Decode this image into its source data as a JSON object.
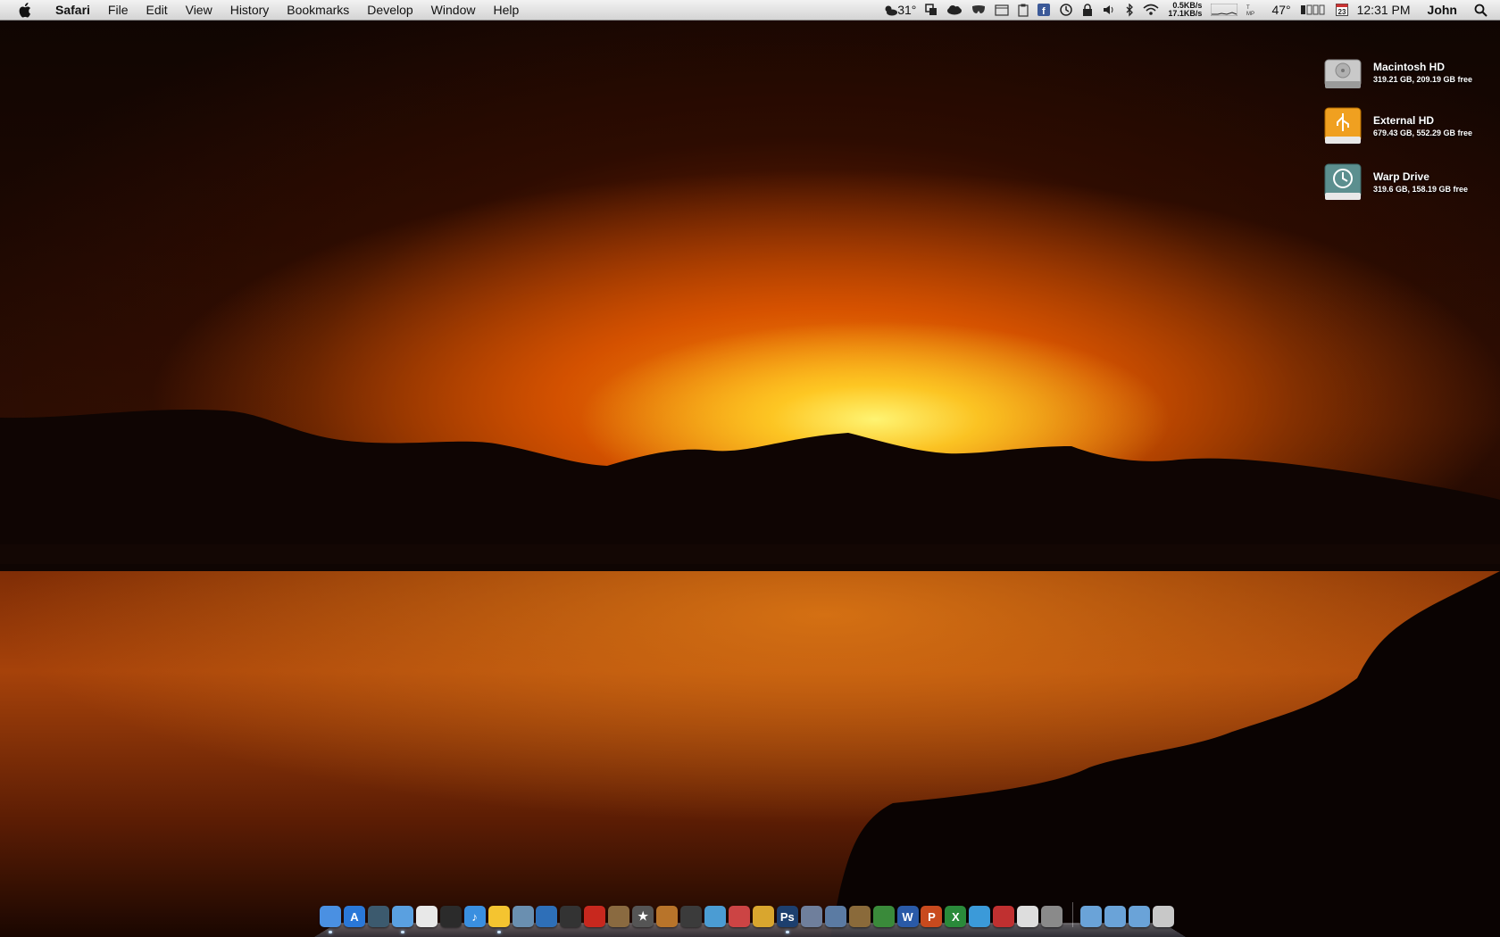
{
  "menubar": {
    "app_name": "Safari",
    "menus": [
      "File",
      "Edit",
      "View",
      "History",
      "Bookmarks",
      "Develop",
      "Window",
      "Help"
    ],
    "weather": "31°",
    "net_up": "0.5KB/s",
    "net_down": "17.1KB/s",
    "temp": "47°",
    "date_day": "23",
    "clock": "12:31 PM",
    "user": "John",
    "icons": [
      "apple-icon",
      "weather-icon",
      "screen-sharing-icon",
      "cloud-icon",
      "mask-icon",
      "window-icon",
      "clipboard-icon",
      "facebook-icon",
      "time-machine-icon",
      "lock-icon",
      "volume-icon",
      "bluetooth-icon",
      "wifi-icon",
      "network-graph-icon",
      "cpu-graph-icon",
      "battery-icon",
      "calendar-icon",
      "spotlight-icon"
    ]
  },
  "desktop": {
    "disks": [
      {
        "name": "Macintosh HD",
        "info": "319.21 GB, 209.19 GB free",
        "icon": "hard-drive-icon"
      },
      {
        "name": "External HD",
        "info": "679.43 GB, 552.29 GB free",
        "icon": "usb-drive-icon"
      },
      {
        "name": "Warp Drive",
        "info": "319.6 GB, 158.19 GB free",
        "icon": "time-machine-drive-icon"
      }
    ]
  },
  "dock": {
    "apps": [
      {
        "name": "finder",
        "color": "#4a90e2",
        "glyph": "",
        "running": true
      },
      {
        "name": "app-store",
        "color": "#2a78d8",
        "glyph": "A",
        "running": false
      },
      {
        "name": "time-machine",
        "color": "#3c5a6e",
        "glyph": "",
        "running": false
      },
      {
        "name": "safari",
        "color": "#5aa0e0",
        "glyph": "",
        "running": true
      },
      {
        "name": "chrome",
        "color": "#e8e8e8",
        "glyph": "",
        "running": false
      },
      {
        "name": "aperture",
        "color": "#2b2b2b",
        "glyph": "",
        "running": false
      },
      {
        "name": "itunes",
        "color": "#3a8fe0",
        "glyph": "♪",
        "running": false
      },
      {
        "name": "adium",
        "color": "#f4c430",
        "glyph": "",
        "running": true
      },
      {
        "name": "iphoto",
        "color": "#6a8fb0",
        "glyph": "",
        "running": false
      },
      {
        "name": "network",
        "color": "#2e6fb8",
        "glyph": "",
        "running": false
      },
      {
        "name": "dvd-player",
        "color": "#333",
        "glyph": "",
        "running": false
      },
      {
        "name": "acrobat",
        "color": "#c8281e",
        "glyph": "",
        "running": false
      },
      {
        "name": "preview",
        "color": "#8a6a40",
        "glyph": "",
        "running": false
      },
      {
        "name": "imovie",
        "color": "#555",
        "glyph": "★",
        "running": false
      },
      {
        "name": "garageband",
        "color": "#b8742a",
        "glyph": "",
        "running": false
      },
      {
        "name": "final-cut",
        "color": "#3b3b3b",
        "glyph": "",
        "running": false
      },
      {
        "name": "pixelmator",
        "color": "#4b9cd3",
        "glyph": "",
        "running": false
      },
      {
        "name": "brushes",
        "color": "#c44",
        "glyph": "",
        "running": false
      },
      {
        "name": "sketch",
        "color": "#d9a62e",
        "glyph": "",
        "running": false
      },
      {
        "name": "photoshop",
        "color": "#1d3f6e",
        "glyph": "Ps",
        "running": true
      },
      {
        "name": "textedit",
        "color": "#6f7f9c",
        "glyph": "",
        "running": false
      },
      {
        "name": "xcode",
        "color": "#5b7ba3",
        "glyph": "",
        "running": false
      },
      {
        "name": "keynote",
        "color": "#8a6a3a",
        "glyph": "",
        "running": false
      },
      {
        "name": "numbers",
        "color": "#3a8a3a",
        "glyph": "",
        "running": false
      },
      {
        "name": "word",
        "color": "#2a5aa8",
        "glyph": "W",
        "running": false
      },
      {
        "name": "powerpoint",
        "color": "#c84a1e",
        "glyph": "P",
        "running": false
      },
      {
        "name": "excel",
        "color": "#2a8a3a",
        "glyph": "X",
        "running": false
      },
      {
        "name": "messenger",
        "color": "#3b9ad9",
        "glyph": "",
        "running": false
      },
      {
        "name": "toolbox",
        "color": "#c03030",
        "glyph": "",
        "running": false
      },
      {
        "name": "script-editor",
        "color": "#ddd",
        "glyph": "",
        "running": false
      },
      {
        "name": "system-preferences",
        "color": "#8a8a8a",
        "glyph": "",
        "running": false
      }
    ],
    "stacks": [
      {
        "name": "applications-folder",
        "color": "#6aa3d8"
      },
      {
        "name": "documents-folder",
        "color": "#6aa3d8"
      },
      {
        "name": "downloads-folder",
        "color": "#6aa3d8"
      },
      {
        "name": "trash",
        "color": "#c8c8c8"
      }
    ]
  }
}
